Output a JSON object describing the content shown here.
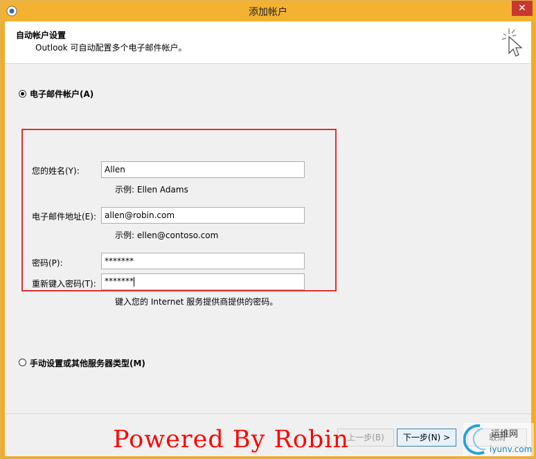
{
  "window": {
    "title": "添加帐户",
    "close_glyph": "✕"
  },
  "header": {
    "title": "自动帐户设置",
    "subtitle": "Outlook 可自动配置多个电子邮件帐户。"
  },
  "options": {
    "email_account_label": "电子邮件帐户(A)",
    "manual_setup_label": "手动设置或其他服务器类型(M)"
  },
  "form": {
    "name_label": "您的姓名(Y):",
    "name_value": "Allen",
    "name_hint": "示例: Ellen Adams",
    "email_label": "电子邮件地址(E):",
    "email_value": "allen@robin.com",
    "email_hint": "示例: ellen@contoso.com",
    "password_label": "密码(P):",
    "password_value": "*******",
    "retype_label": "重新键入密码(T):",
    "retype_value": "*******",
    "password_hint": "键入您的 Internet 服务提供商提供的密码。"
  },
  "footer": {
    "back_label": "上一步(B)",
    "next_label": "下一步(N) >",
    "cancel_label": "取消"
  },
  "watermark": {
    "text": "Powered By Robin"
  },
  "logo": {
    "top_text": "运维网",
    "bottom_text": "iyunv.com"
  },
  "colors": {
    "titlebar": "#f4b232",
    "highlight_box": "#e03030",
    "watermark": "#ff0000"
  }
}
